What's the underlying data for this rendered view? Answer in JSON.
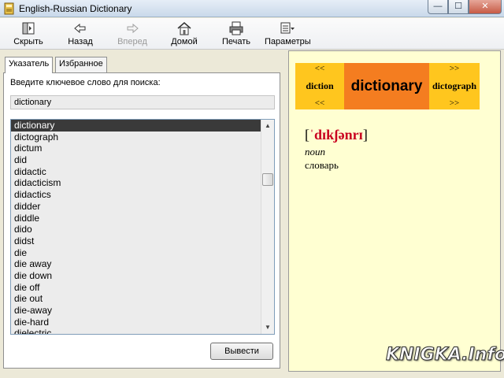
{
  "window": {
    "title": "English-Russian Dictionary",
    "min_glyph": "—",
    "max_glyph": "☐",
    "close_glyph": "✕"
  },
  "toolbar": {
    "hide_label": "Скрыть",
    "back_label": "Назад",
    "forward_label": "Вперед",
    "home_label": "Домой",
    "print_label": "Печать",
    "options_label": "Параметры"
  },
  "left": {
    "tabs": [
      {
        "label": "Указатель",
        "active": true
      },
      {
        "label": "Избранное",
        "active": false
      }
    ],
    "prompt": "Введите ключевое слово для поиска:",
    "search_value": "dictionary",
    "words": [
      "dictionary",
      "dictograph",
      "dictum",
      "did",
      "didactic",
      "didacticism",
      "didactics",
      "didder",
      "diddle",
      "dido",
      "didst",
      "die",
      "die away",
      "die down",
      "die off",
      "die out",
      "die-away",
      "die-hard",
      "dielectric"
    ],
    "selected_index": 0,
    "scroll_up_glyph": "▲",
    "scroll_down_glyph": "▼",
    "output_button": "Вывести"
  },
  "entry": {
    "prev_arrow": "<<",
    "next_arrow": ">>",
    "prev_word": "diction",
    "current_word": "dictionary",
    "next_word": "dictograph",
    "bracket_open": "[",
    "transcription": "ˈdɪkʃənrɪ",
    "bracket_close": "]",
    "part_of_speech": "noun",
    "translation": "словарь"
  },
  "colors": {
    "nav_side": "#ffc61e",
    "nav_current": "#f47d20",
    "entry_bg": "#ffffd2",
    "transcription": "#c9001f"
  },
  "watermark": "KNIGKA.Info"
}
